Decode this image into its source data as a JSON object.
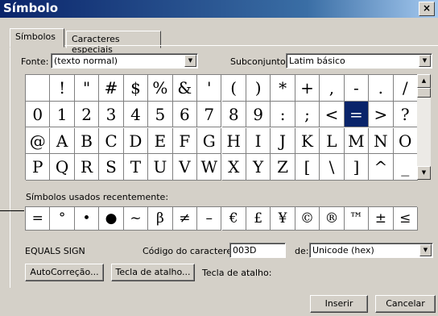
{
  "window": {
    "title": "Símbolo",
    "close_glyph": "×"
  },
  "tabs": [
    {
      "label": "Símbolos",
      "active": true
    },
    {
      "label": "Caracteres especiais",
      "active": false
    }
  ],
  "font": {
    "label": "Fonte:",
    "value": "(texto normal)"
  },
  "subset": {
    "label": "Subconjunto:",
    "value": "Latim básico"
  },
  "symbols": [
    " ",
    "!",
    "\"",
    "#",
    "$",
    "%",
    "&",
    "'",
    "(",
    ")",
    "*",
    "+",
    ",",
    "-",
    ".",
    "/",
    "0",
    "1",
    "2",
    "3",
    "4",
    "5",
    "6",
    "7",
    "8",
    "9",
    ":",
    ";",
    "<",
    "=",
    ">",
    "?",
    "@",
    "A",
    "B",
    "C",
    "D",
    "E",
    "F",
    "G",
    "H",
    "I",
    "J",
    "K",
    "L",
    "M",
    "N",
    "O",
    "P",
    "Q",
    "R",
    "S",
    "T",
    "U",
    "V",
    "W",
    "X",
    "Y",
    "Z",
    "[",
    "\\",
    "]",
    "^",
    "_"
  ],
  "selected_index": 29,
  "recent": {
    "label": "Símbolos usados recentemente:",
    "items": [
      "=",
      "°",
      "•",
      "●",
      "~",
      "β",
      "≠",
      "–",
      "€",
      "£",
      "¥",
      "©",
      "®",
      "™",
      "±",
      "≤"
    ]
  },
  "char_name": "EQUALS SIGN",
  "char_code": {
    "label": "Código do caractere:",
    "value": "003D"
  },
  "from": {
    "label": "de:",
    "value": "Unicode (hex)"
  },
  "buttons": {
    "autocorrect": "AutoCorreção...",
    "shortcut_key": "Tecla de atalho...",
    "shortcut_label": "Tecla de atalho:",
    "insert": "Inserir",
    "cancel": "Cancelar"
  },
  "icons": {
    "dropdown": "▼",
    "scroll_up": "▲",
    "scroll_down": "▼"
  }
}
